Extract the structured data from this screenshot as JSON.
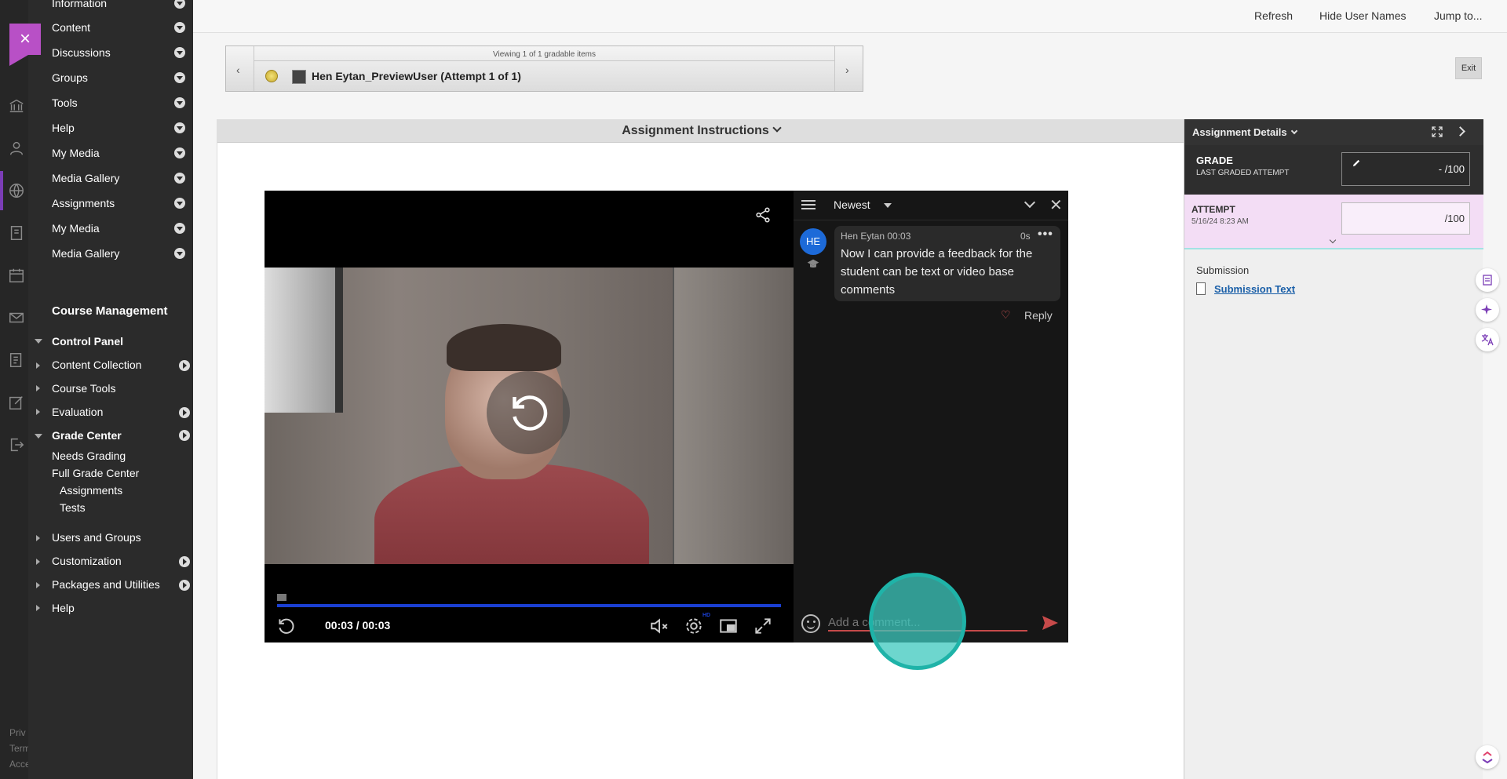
{
  "course_menu": {
    "items": [
      {
        "label": "Information"
      },
      {
        "label": "Content"
      },
      {
        "label": "Discussions"
      },
      {
        "label": "Groups"
      },
      {
        "label": "Tools"
      },
      {
        "label": "Help"
      },
      {
        "label": "My Media"
      },
      {
        "label": "Media Gallery"
      },
      {
        "label": "Assignments"
      },
      {
        "label": "My Media"
      },
      {
        "label": "Media Gallery"
      }
    ],
    "management_title": "Course Management",
    "control_panel": "Control Panel",
    "cp_items": {
      "content_collection": "Content Collection",
      "course_tools": "Course Tools",
      "evaluation": "Evaluation",
      "grade_center": "Grade Center",
      "needs_grading": "Needs Grading",
      "full_grade_center": "Full Grade Center",
      "assignments": "Assignments",
      "tests": "Tests",
      "users_groups": "Users and Groups",
      "customization": "Customization",
      "packages_utilities": "Packages and Utilities",
      "help": "Help"
    },
    "footer": [
      "Priv",
      "Term",
      "Acce"
    ]
  },
  "topbar": {
    "refresh": "Refresh",
    "hide_user_names": "Hide User Names",
    "jump_to": "Jump to..."
  },
  "navigator": {
    "viewing": "Viewing 1 of 1 gradable items",
    "student": "Hen Eytan_PreviewUser (Attempt 1 of 1)",
    "exit": "Exit"
  },
  "instructions_title": "Assignment Instructions",
  "player": {
    "time": "00:03 / 00:03",
    "progress": 1.0,
    "hd_badge": "HD"
  },
  "comments": {
    "sort_label": "Newest",
    "avatar_initials": "HE",
    "author": "Hen Eytan 00:03",
    "ago": "0s",
    "dots": "•••",
    "message": "Now I can provide a feedback for the student can be text or video base comments",
    "reply": "Reply",
    "input_placeholder": "Add a comment..."
  },
  "details": {
    "title": "Assignment Details",
    "grade_label": "GRADE",
    "grade_sub": "LAST GRADED ATTEMPT",
    "grade_value": "- /100",
    "attempt_label": "ATTEMPT",
    "attempt_date": "5/16/24 8:23 AM",
    "attempt_value": "/100",
    "submission_label": "Submission",
    "submission_link": "Submission Text"
  },
  "colors": {
    "accent_purple": "#b850c6",
    "progress_blue": "#1a3fd3",
    "attempt_bg": "#f3ddf5",
    "click_ring": "#1fb3a8"
  }
}
